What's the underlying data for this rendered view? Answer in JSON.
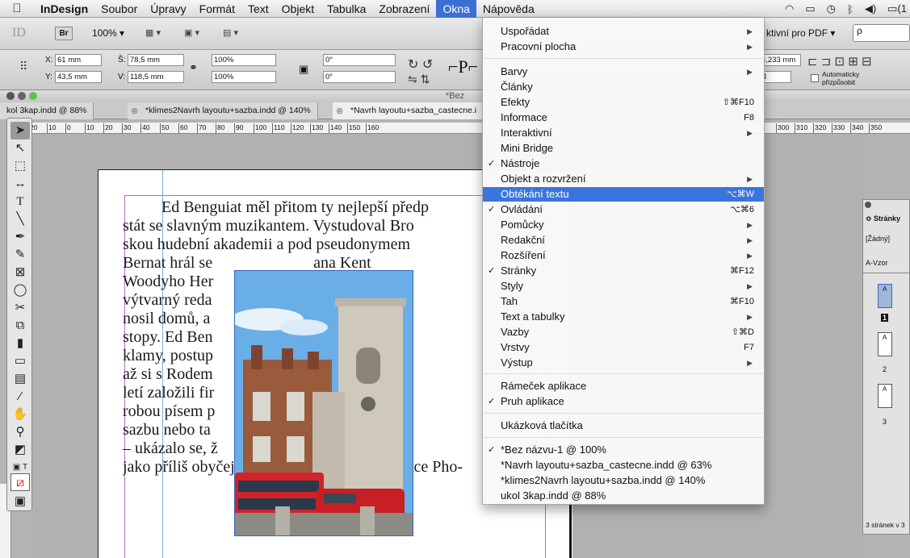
{
  "menubar": {
    "app": "InDesign",
    "items": [
      "Soubor",
      "Úpravy",
      "Formát",
      "Text",
      "Objekt",
      "Tabulka",
      "Zobrazení",
      "Okna",
      "Nápověda"
    ],
    "active": "Okna"
  },
  "appbar": {
    "id_logo": "ID",
    "br": "Br",
    "zoom": "100% ▾",
    "pdf_preset": "ktivní pro PDF ▾",
    "search": "ρ"
  },
  "control": {
    "x_label": "X:",
    "x_value": "61 mm",
    "y_label": "Y:",
    "y_value": "43,5 mm",
    "w_label": "Š:",
    "w_value": "78,5 mm",
    "h_label": "V:",
    "h_value": "118,5 mm",
    "scale_x": "100%",
    "scale_y": "100%",
    "rotate": "0°",
    "shear": "0°",
    "size_value": "4,233 mm",
    "auto_fit": "Automaticky přizpůsobit"
  },
  "window": {
    "title": "*Bez"
  },
  "tabs": [
    "kol 3kap.indd @ 88%",
    "*klimes2Navrh layoutu+sazba.indd @ 140%",
    "*Navrh layoutu+sazba_castecne.i"
  ],
  "ruler": [
    "0",
    "20",
    "10",
    "0",
    "10",
    "20",
    "30",
    "40",
    "50",
    "60",
    "70",
    "80",
    "90",
    "100",
    "110",
    "120",
    "130",
    "140",
    "150",
    "160",
    "300",
    "310",
    "320",
    "330",
    "340",
    "350"
  ],
  "body_text": [
    "Ed Benguiat měl přitom ty nejlepší předp",
    "stát se slavným muzikantem. Vystudoval Bro",
    "skou hudební akademii a pod pseudonymem",
    "Bernat hrál se                         ana Kent",
    "Woodyho Her                          c pracova",
    "výtvarný reda                         práci si č",
    "nosil domů, a                          ně zanecl",
    "stopy. Ed Ben                         orskou šk",
    "klamy, postup                         na agentu",
    "až si s Rodem                         m 60. let",
    "letí založili fir                        abývali s",
    "robou písem p                        ovinku –",
    "sazbu nebo ta                         psacích",
    "– ukázalo se, ž                        se začínají zdát",
    "jako příliš obyčejná. Kvalitní písma s produkce Pho-"
  ],
  "menu": {
    "items": [
      {
        "label": "Uspořádat",
        "submenu": true
      },
      {
        "label": "Pracovní plocha",
        "submenu": true
      },
      {
        "sep": true
      },
      {
        "label": "Barvy",
        "submenu": true
      },
      {
        "label": "Články"
      },
      {
        "label": "Efekty",
        "shortcut": "⇧⌘F10"
      },
      {
        "label": "Informace",
        "shortcut": "F8"
      },
      {
        "label": "Interaktivní",
        "submenu": true
      },
      {
        "label": "Mini Bridge"
      },
      {
        "label": "Nástroje",
        "checked": true
      },
      {
        "label": "Objekt a rozvržení",
        "submenu": true
      },
      {
        "label": "Obtékání textu",
        "shortcut": "⌥⌘W",
        "highlighted": true
      },
      {
        "label": "Ovládání",
        "shortcut": "⌥⌘6",
        "checked": true
      },
      {
        "label": "Pomůcky",
        "submenu": true
      },
      {
        "label": "Redakční",
        "submenu": true
      },
      {
        "label": "Rozšíření",
        "submenu": true
      },
      {
        "label": "Stránky",
        "shortcut": "⌘F12",
        "checked": true
      },
      {
        "label": "Styly",
        "submenu": true
      },
      {
        "label": "Tah",
        "shortcut": "⌘F10"
      },
      {
        "label": "Text a tabulky",
        "submenu": true
      },
      {
        "label": "Vazby",
        "shortcut": "⇧⌘D"
      },
      {
        "label": "Vrstvy",
        "shortcut": "F7"
      },
      {
        "label": "Výstup",
        "submenu": true
      },
      {
        "sep": true
      },
      {
        "label": "Rámeček aplikace"
      },
      {
        "label": "Pruh aplikace",
        "checked": true
      },
      {
        "sep": true
      },
      {
        "label": "Ukázková tlačítka"
      },
      {
        "sep": true
      },
      {
        "label": "*Bez názvu-1 @ 100%",
        "checked": true
      },
      {
        "label": "*Navrh layoutu+sazba_castecne.indd @ 63%"
      },
      {
        "label": "*klimes2Navrh layoutu+sazba.indd @ 140%"
      },
      {
        "label": "ukol 3kap.indd @ 88%"
      }
    ]
  },
  "pages_panel": {
    "title": "≎ Stránky",
    "none": "[Žádný]",
    "master": "A-Vzor",
    "page_labels": [
      "A",
      "A",
      "A"
    ],
    "page_numbers": [
      "1",
      "2",
      "3"
    ],
    "footer": "3 stránek v 3"
  },
  "colors": {
    "menu_highlight": "#3b74dc",
    "frame": "#3a66c4",
    "margin": "#b070c0"
  }
}
